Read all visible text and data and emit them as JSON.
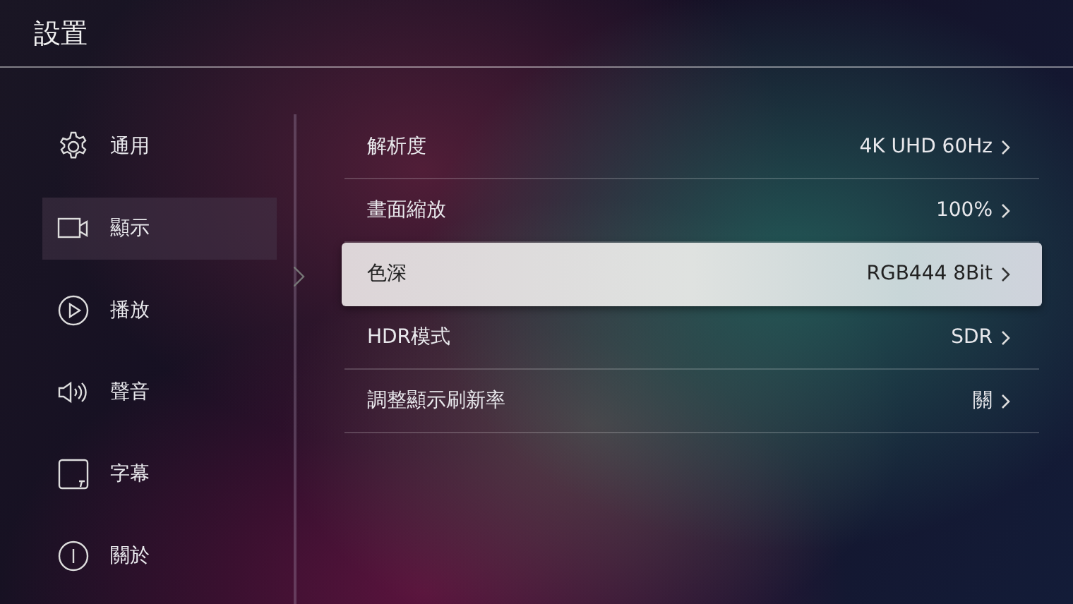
{
  "window": {
    "title": "設置"
  },
  "sidebar": {
    "items": [
      {
        "label": "通用",
        "selected": false
      },
      {
        "label": "顯示",
        "selected": true
      },
      {
        "label": "播放",
        "selected": false
      },
      {
        "label": "聲音",
        "selected": false
      },
      {
        "label": "字幕",
        "selected": false
      },
      {
        "label": "關於",
        "selected": false
      }
    ]
  },
  "settings": [
    {
      "label": "解析度",
      "value": "4K UHD 60Hz",
      "selected": false
    },
    {
      "label": "畫面縮放",
      "value": "100%",
      "selected": false
    },
    {
      "label": "色深",
      "value": "RGB444 8Bit",
      "selected": true
    },
    {
      "label": "HDR模式",
      "value": "SDR",
      "selected": false
    },
    {
      "label": "調整顯示刷新率",
      "value": "關",
      "selected": false
    }
  ]
}
